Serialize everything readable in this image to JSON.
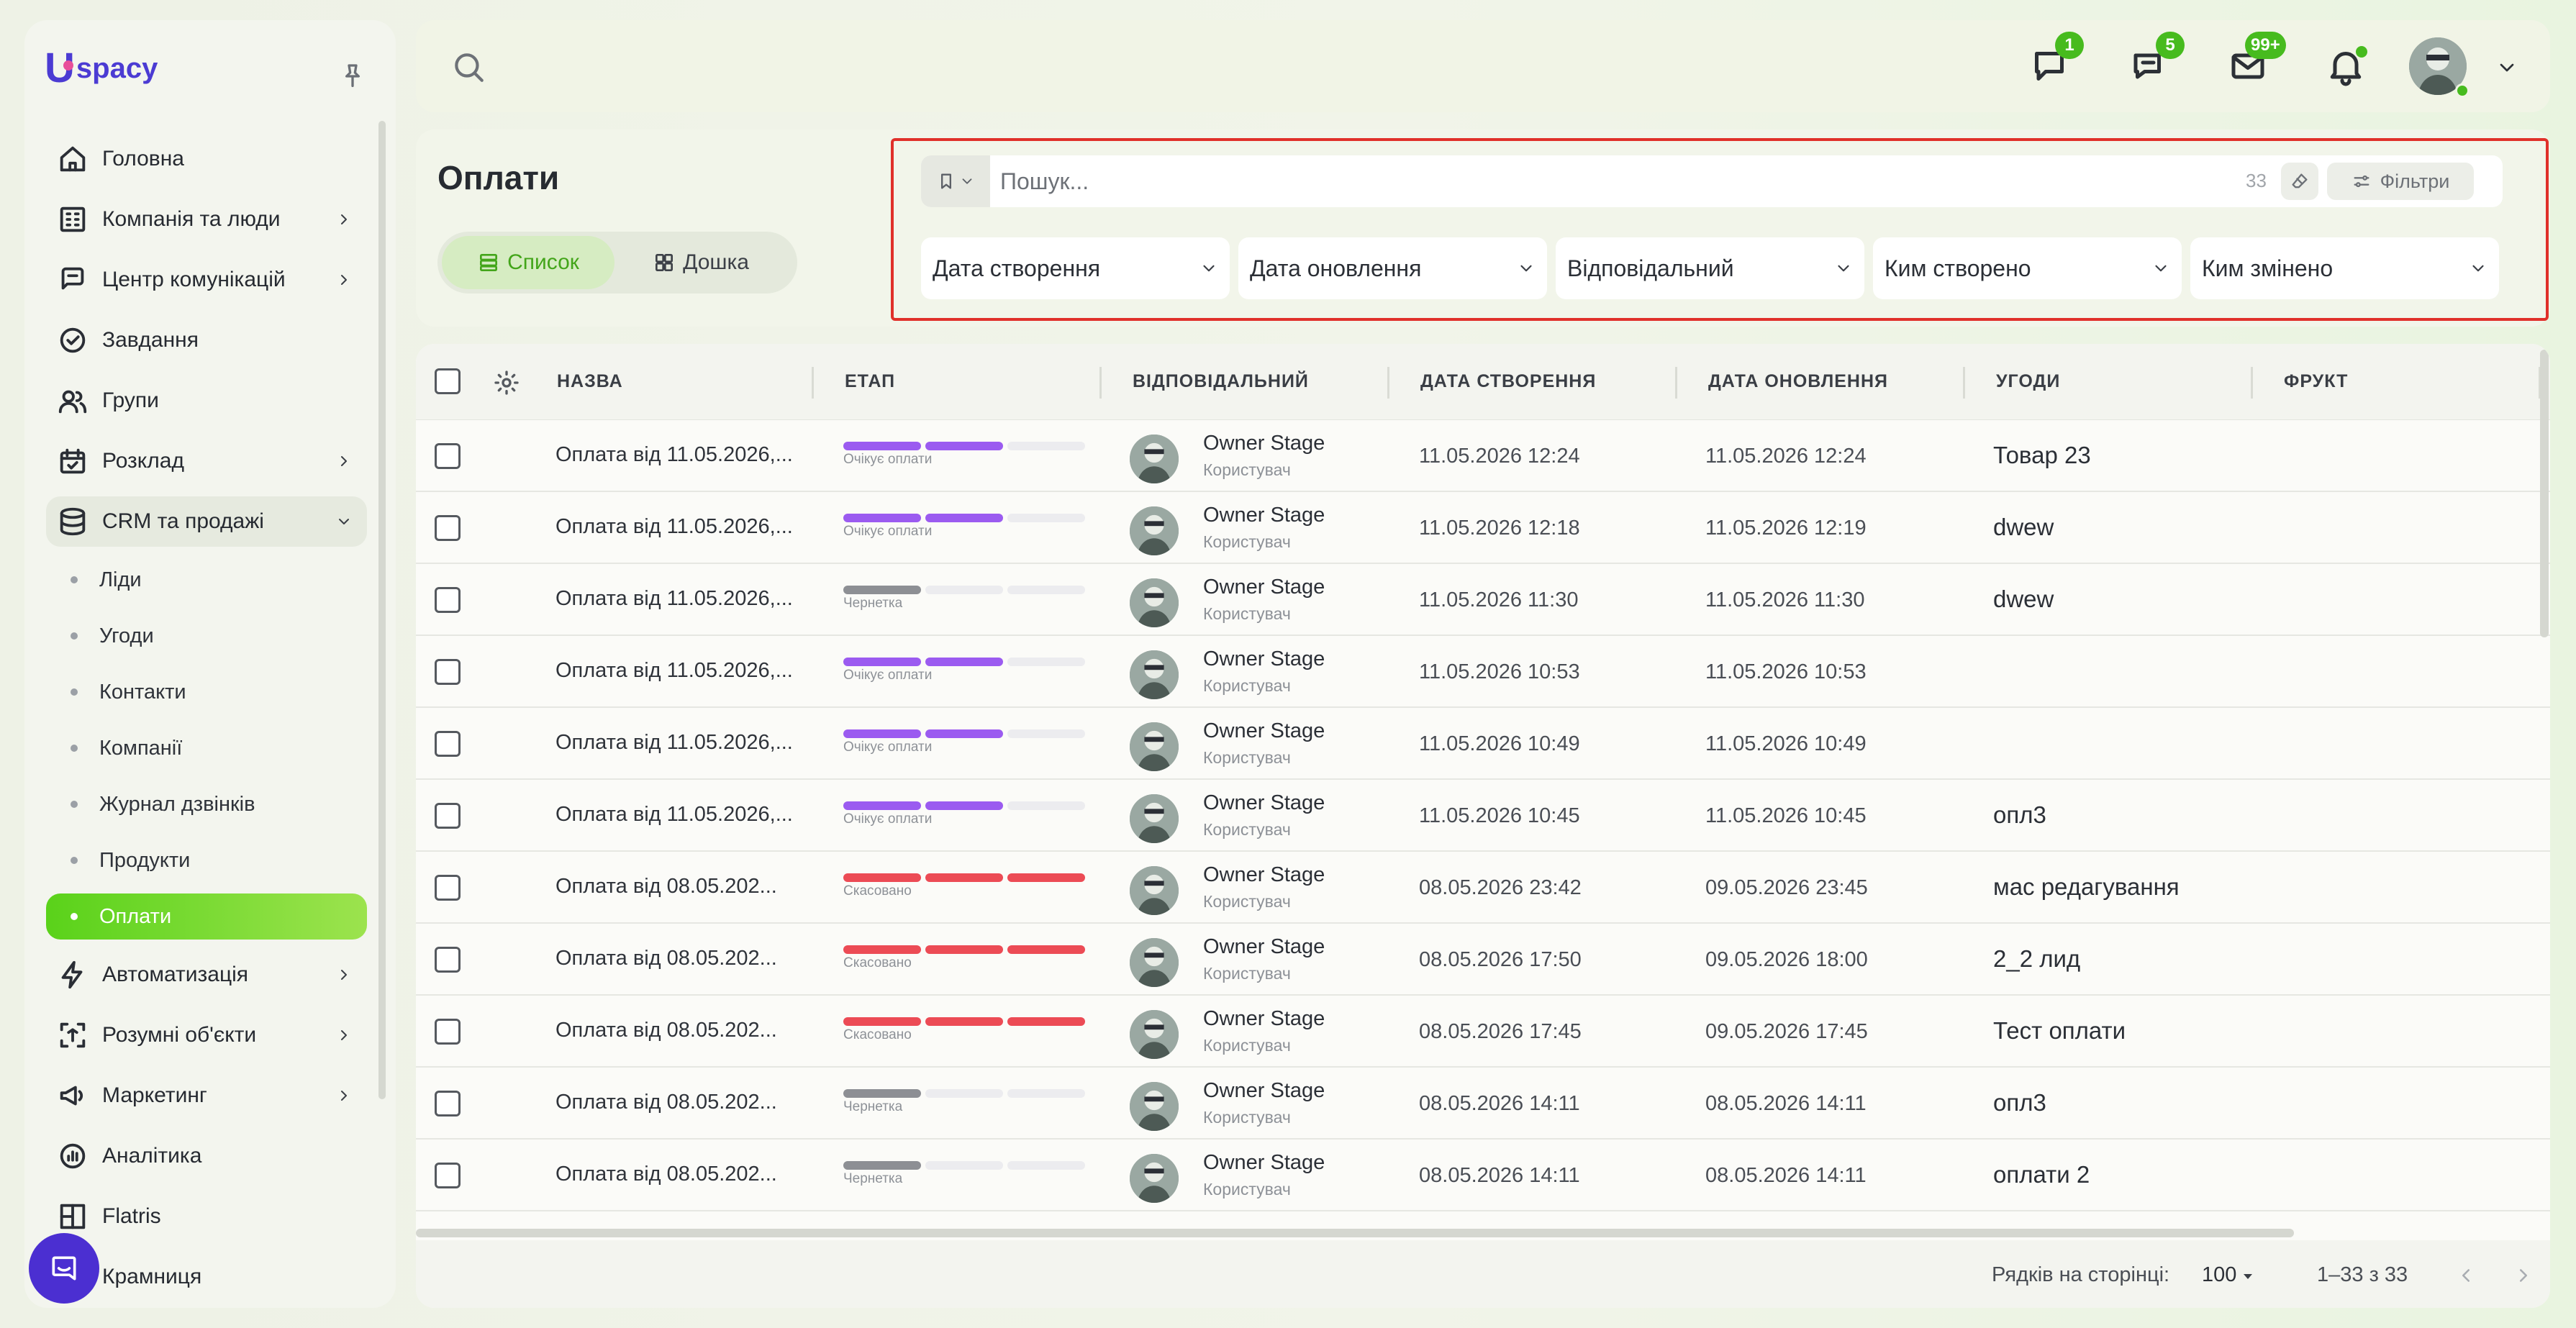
{
  "brand": {
    "logo_letter": "U",
    "logo_text": "spacy",
    "accent": "#5ad21a",
    "primary": "#4b3bd3"
  },
  "sidebar": {
    "items": [
      {
        "label": "Головна",
        "icon": "home-icon",
        "chevron": false
      },
      {
        "label": "Компанія та люди",
        "icon": "company-icon",
        "chevron": true
      },
      {
        "label": "Центр комунікацій",
        "icon": "communication-icon",
        "chevron": true
      },
      {
        "label": "Завдання",
        "icon": "task-check-icon",
        "chevron": false
      },
      {
        "label": "Групи",
        "icon": "groups-icon",
        "chevron": false
      },
      {
        "label": "Розклад",
        "icon": "calendar-icon",
        "chevron": true
      },
      {
        "label": "CRM та продажі",
        "icon": "database-icon",
        "chevron": true,
        "open": true
      }
    ],
    "crm_subitems": [
      "Ліди",
      "Угоди",
      "Контакти",
      "Компанії",
      "Журнал дзвінків",
      "Продукти",
      "Оплати"
    ],
    "crm_active": "Оплати",
    "items_after": [
      {
        "label": "Автоматизація",
        "icon": "lightning-icon",
        "chevron": true
      },
      {
        "label": "Розумні об'єкти",
        "icon": "smart-object-icon",
        "chevron": true
      },
      {
        "label": "Маркетинг",
        "icon": "marketing-icon",
        "chevron": true
      },
      {
        "label": "Аналітика",
        "icon": "analytics-icon",
        "chevron": false
      },
      {
        "label": "Flatris",
        "icon": "flatris-icon",
        "chevron": false
      },
      {
        "label": "Крамниця",
        "icon": "shop-icon",
        "chevron": false
      }
    ]
  },
  "topbar": {
    "chat_badge": "1",
    "messages_badge": "5",
    "mail_badge": "99+"
  },
  "page": {
    "title": "Оплати",
    "view_list": "Список",
    "view_board": "Дошка"
  },
  "filters": {
    "search_placeholder": "Пошук...",
    "count": "33",
    "filters_label": "Фільтри",
    "selects": [
      "Дата створення",
      "Дата оновлення",
      "Відповідальний",
      "Ким створено",
      "Ким змінено"
    ]
  },
  "table": {
    "columns": [
      "НАЗВА",
      "ЕТАП",
      "ВІДПОВІДАЛЬНИЙ",
      "ДАТА СТВОРЕННЯ",
      "ДАТА ОНОВЛЕННЯ",
      "УГОДИ",
      "ФРУКТ"
    ],
    "stage_colors": {
      "Очікує оплати": "#9b5bf0",
      "Чернетка": "#8d8f94",
      "Скасовано": "#ec4b55"
    },
    "rows": [
      {
        "name": "Оплата від 11.05.2026,...",
        "stage": "Очікує оплати",
        "stage_level": 2,
        "user": "Owner Stage",
        "role": "Користувач",
        "created": "11.05.2026 12:24",
        "updated": "11.05.2026 12:24",
        "deal": "Товар 23"
      },
      {
        "name": "Оплата від 11.05.2026,...",
        "stage": "Очікує оплати",
        "stage_level": 2,
        "user": "Owner Stage",
        "role": "Користувач",
        "created": "11.05.2026 12:18",
        "updated": "11.05.2026 12:19",
        "deal": "dwew"
      },
      {
        "name": "Оплата від 11.05.2026,...",
        "stage": "Чернетка",
        "stage_level": 1,
        "user": "Owner Stage",
        "role": "Користувач",
        "created": "11.05.2026 11:30",
        "updated": "11.05.2026 11:30",
        "deal": "dwew"
      },
      {
        "name": "Оплата від 11.05.2026,...",
        "stage": "Очікує оплати",
        "stage_level": 2,
        "user": "Owner Stage",
        "role": "Користувач",
        "created": "11.05.2026 10:53",
        "updated": "11.05.2026 10:53",
        "deal": ""
      },
      {
        "name": "Оплата від 11.05.2026,...",
        "stage": "Очікує оплати",
        "stage_level": 2,
        "user": "Owner Stage",
        "role": "Користувач",
        "created": "11.05.2026 10:49",
        "updated": "11.05.2026 10:49",
        "deal": ""
      },
      {
        "name": "Оплата від 11.05.2026,...",
        "stage": "Очікує оплати",
        "stage_level": 2,
        "user": "Owner Stage",
        "role": "Користувач",
        "created": "11.05.2026 10:45",
        "updated": "11.05.2026 10:45",
        "deal": "опл3"
      },
      {
        "name": "Оплата від 08.05.202...",
        "stage": "Скасовано",
        "stage_level": 3,
        "user": "Owner Stage",
        "role": "Користувач",
        "created": "08.05.2026 23:42",
        "updated": "09.05.2026 23:45",
        "deal": "мас редагування"
      },
      {
        "name": "Оплата від 08.05.202...",
        "stage": "Скасовано",
        "stage_level": 3,
        "user": "Owner Stage",
        "role": "Користувач",
        "created": "08.05.2026 17:50",
        "updated": "09.05.2026 18:00",
        "deal": "2_2 лид"
      },
      {
        "name": "Оплата від 08.05.202...",
        "stage": "Скасовано",
        "stage_level": 3,
        "user": "Owner Stage",
        "role": "Користувач",
        "created": "08.05.2026 17:45",
        "updated": "09.05.2026 17:45",
        "deal": "Тест оплати"
      },
      {
        "name": "Оплата від 08.05.202...",
        "stage": "Чернетка",
        "stage_level": 1,
        "user": "Owner Stage",
        "role": "Користувач",
        "created": "08.05.2026 14:11",
        "updated": "08.05.2026 14:11",
        "deal": "опл3"
      },
      {
        "name": "Оплата від 08.05.202...",
        "stage": "Чернетка",
        "stage_level": 1,
        "user": "Owner Stage",
        "role": "Користувач",
        "created": "08.05.2026 14:11",
        "updated": "08.05.2026 14:11",
        "deal": "оплати 2"
      }
    ]
  },
  "footer": {
    "rows_per_page_label": "Рядків на сторінці:",
    "rows_per_page": "100",
    "range": "1–33 з 33"
  }
}
